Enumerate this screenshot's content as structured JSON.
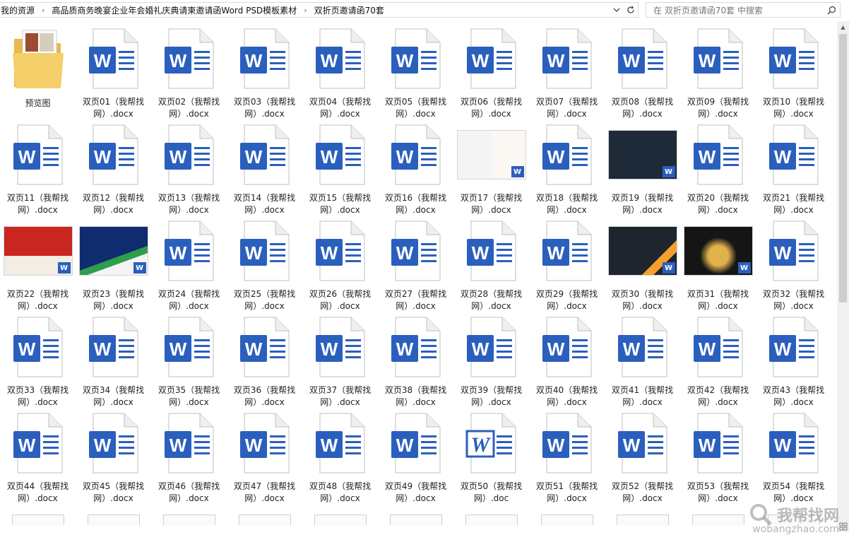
{
  "breadcrumb": [
    "我的资源",
    "高品质商务晚宴企业年会婚礼庆典请柬邀请函Word PSD模板素材",
    "双折页邀请函70套"
  ],
  "search": {
    "placeholder": "在 双折页邀请函70套 中搜索"
  },
  "items": [
    {
      "kind": "folder",
      "line1": "预览图",
      "line2": ""
    },
    {
      "kind": "word",
      "line1": "双页01（我帮找",
      "line2": "网）.docx"
    },
    {
      "kind": "word",
      "line1": "双页02（我帮找",
      "line2": "网）.docx"
    },
    {
      "kind": "word",
      "line1": "双页03（我帮找",
      "line2": "网）.docx"
    },
    {
      "kind": "word",
      "line1": "双页04（我帮找",
      "line2": "网）.docx"
    },
    {
      "kind": "word",
      "line1": "双页05（我帮找",
      "line2": "网）.docx"
    },
    {
      "kind": "word",
      "line1": "双页06（我帮找",
      "line2": "网）.docx"
    },
    {
      "kind": "word",
      "line1": "双页07（我帮找",
      "line2": "网）.docx"
    },
    {
      "kind": "word",
      "line1": "双页08（我帮找",
      "line2": "网）.docx"
    },
    {
      "kind": "word",
      "line1": "双页09（我帮找",
      "line2": "网）.docx"
    },
    {
      "kind": "word",
      "line1": "双页10（我帮找",
      "line2": "网）.docx"
    },
    {
      "kind": "word",
      "line1": "双页11（我帮找",
      "line2": "网）.docx"
    },
    {
      "kind": "word",
      "line1": "双页12（我帮找",
      "line2": "网）.docx"
    },
    {
      "kind": "word",
      "line1": "双页13（我帮找",
      "line2": "网）.docx"
    },
    {
      "kind": "word",
      "line1": "双页14（我帮找",
      "line2": "网）.docx"
    },
    {
      "kind": "word",
      "line1": "双页15（我帮找",
      "line2": "网）.docx"
    },
    {
      "kind": "word",
      "line1": "双页16（我帮找",
      "line2": "网）.docx"
    },
    {
      "kind": "thumb",
      "style": "calligraphy",
      "line1": "双页17（我帮找",
      "line2": "网）.docx"
    },
    {
      "kind": "word",
      "line1": "双页18（我帮找",
      "line2": "网）.docx"
    },
    {
      "kind": "thumb",
      "style": "darkframe",
      "line1": "双页19（我帮找",
      "line2": "网）.docx"
    },
    {
      "kind": "word",
      "line1": "双页20（我帮找",
      "line2": "网）.docx"
    },
    {
      "kind": "word",
      "line1": "双页21（我帮找",
      "line2": "网）.docx"
    },
    {
      "kind": "thumb",
      "style": "red",
      "line1": "双页22（我帮找",
      "line2": "网）.docx"
    },
    {
      "kind": "thumb",
      "style": "navy",
      "line1": "双页23（我帮找",
      "line2": "网）.docx"
    },
    {
      "kind": "word",
      "line1": "双页24（我帮找",
      "line2": "网）.docx"
    },
    {
      "kind": "word",
      "line1": "双页25（我帮找",
      "line2": "网）.docx"
    },
    {
      "kind": "word",
      "line1": "双页26（我帮找",
      "line2": "网）.docx"
    },
    {
      "kind": "word",
      "line1": "双页27（我帮找",
      "line2": "网）.docx"
    },
    {
      "kind": "word",
      "line1": "双页28（我帮找",
      "line2": "网）.docx"
    },
    {
      "kind": "word",
      "line1": "双页29（我帮找",
      "line2": "网）.docx"
    },
    {
      "kind": "thumb",
      "style": "darkorange",
      "line1": "双页30（我帮找",
      "line2": "网）.docx"
    },
    {
      "kind": "thumb",
      "style": "gold",
      "line1": "双页31（我帮找",
      "line2": "网）.docx"
    },
    {
      "kind": "word",
      "line1": "双页32（我帮找",
      "line2": "网）.docx"
    },
    {
      "kind": "word",
      "line1": "双页33（我帮找",
      "line2": "网）.docx"
    },
    {
      "kind": "word",
      "line1": "双页34（我帮找",
      "line2": "网）.docx"
    },
    {
      "kind": "word",
      "line1": "双页35（我帮找",
      "line2": "网）.docx"
    },
    {
      "kind": "word",
      "line1": "双页36（我帮找",
      "line2": "网）.docx"
    },
    {
      "kind": "word",
      "line1": "双页37（我帮找",
      "line2": "网）.docx"
    },
    {
      "kind": "word",
      "line1": "双页38（我帮找",
      "line2": "网）.docx"
    },
    {
      "kind": "word",
      "line1": "双页39（我帮找",
      "line2": "网）.docx"
    },
    {
      "kind": "word",
      "line1": "双页40（我帮找",
      "line2": "网）.docx"
    },
    {
      "kind": "word",
      "line1": "双页41（我帮找",
      "line2": "网）.docx"
    },
    {
      "kind": "word",
      "line1": "双页42（我帮找",
      "line2": "网）.docx"
    },
    {
      "kind": "word",
      "line1": "双页43（我帮找",
      "line2": "网）.docx"
    },
    {
      "kind": "word",
      "line1": "双页44（我帮找",
      "line2": "网）.docx"
    },
    {
      "kind": "word",
      "line1": "双页45（我帮找",
      "line2": "网）.docx"
    },
    {
      "kind": "word",
      "line1": "双页46（我帮找",
      "line2": "网）.docx"
    },
    {
      "kind": "word",
      "line1": "双页47（我帮找",
      "line2": "网）.docx"
    },
    {
      "kind": "word",
      "line1": "双页48（我帮找",
      "line2": "网）.docx"
    },
    {
      "kind": "word",
      "line1": "双页49（我帮找",
      "line2": "网）.docx"
    },
    {
      "kind": "wordold",
      "line1": "双页50（我帮找",
      "line2": "网）.doc"
    },
    {
      "kind": "word",
      "line1": "双页51（我帮找",
      "line2": "网）.docx"
    },
    {
      "kind": "word",
      "line1": "双页52（我帮找",
      "line2": "网）.docx"
    },
    {
      "kind": "word",
      "line1": "双页53（我帮找",
      "line2": "网）.docx"
    },
    {
      "kind": "word",
      "line1": "双页54（我帮找",
      "line2": "网）.docx"
    }
  ],
  "watermark": {
    "text": "我帮找网",
    "sub": "wobangzhao.com"
  },
  "colors": {
    "word_blue": "#2b5fbd",
    "accent": "#0078d7"
  }
}
